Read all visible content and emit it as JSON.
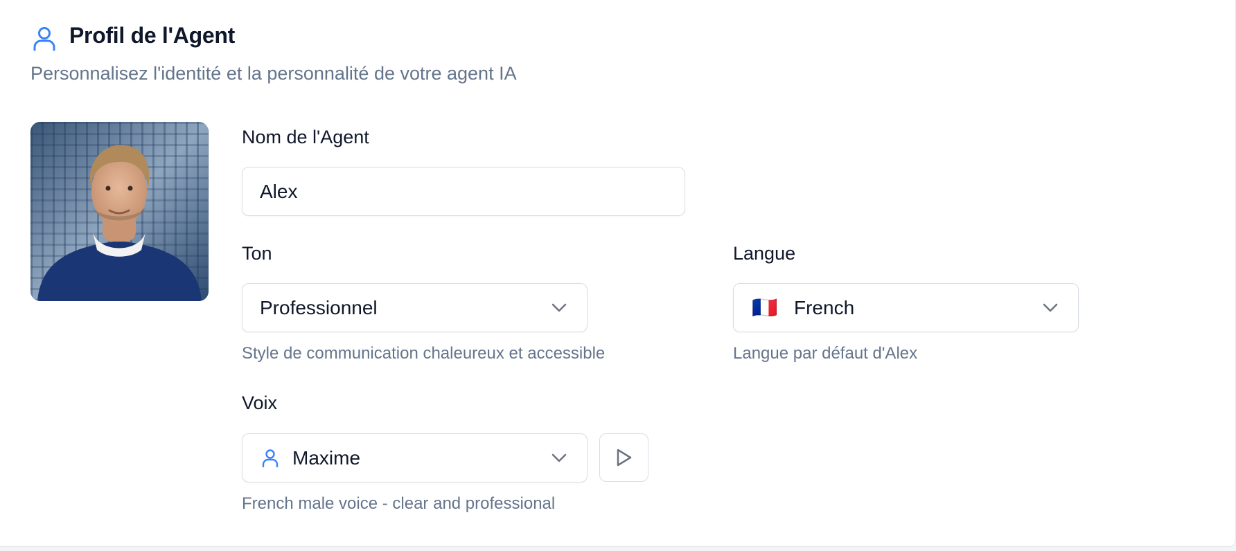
{
  "header": {
    "icon": "user-icon",
    "title": "Profil de l'Agent",
    "subtitle": "Personnalisez l'identité et la personnalité de votre agent IA"
  },
  "avatar": {
    "alt": "Agent avatar photo"
  },
  "name_field": {
    "label": "Nom de l'Agent",
    "value": "Alex"
  },
  "tone": {
    "label": "Ton",
    "selected": "Professionnel",
    "hint": "Style de communication chaleureux et accessible"
  },
  "language": {
    "label": "Langue",
    "flag": "🇫🇷",
    "selected": "French",
    "hint": "Langue par défaut d'Alex"
  },
  "voice": {
    "label": "Voix",
    "icon": "user-icon",
    "selected": "Maxime",
    "hint": "French male voice - clear and professional",
    "play_icon": "play-icon"
  },
  "colors": {
    "accent": "#3b82f6",
    "muted_text": "#64748b",
    "border": "#d8dde5"
  }
}
